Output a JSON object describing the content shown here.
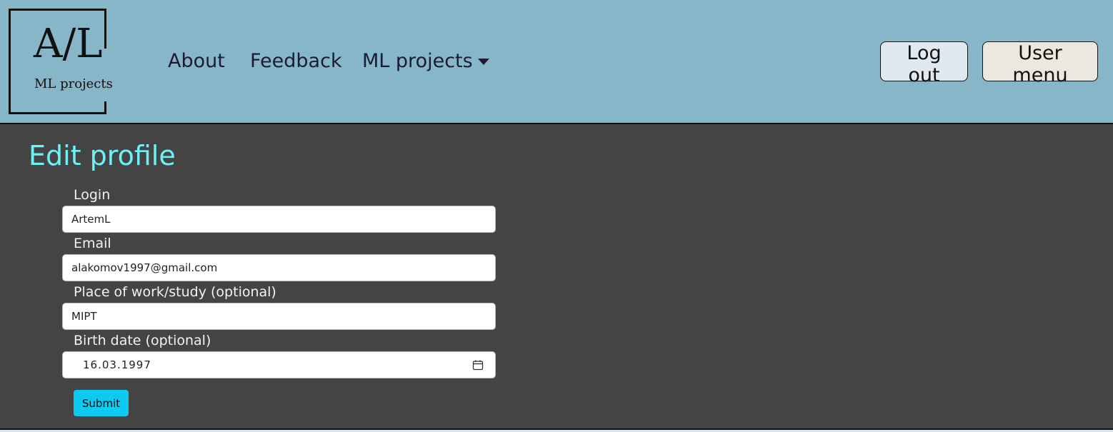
{
  "logo": {
    "big": "A/L",
    "small": "ML projects"
  },
  "nav": {
    "about": "About",
    "feedback": "Feedback",
    "ml_projects": "ML projects",
    "logout": "Log out",
    "user_menu": "User menu"
  },
  "page": {
    "title": "Edit profile"
  },
  "form": {
    "login_label": "Login",
    "login_value": "ArtemL",
    "email_label": "Email",
    "email_value": "alakomov1997@gmail.com",
    "work_label": "Place of work/study (optional)",
    "work_value": "MIPT",
    "birth_label": "Birth date (optional)",
    "birth_value": "16.03.1997",
    "submit_label": "Submit"
  },
  "colors": {
    "navbar": "#87b6c9",
    "background": "#444444",
    "title": "#6ff0f5",
    "submit": "#0dcaf0"
  },
  "icons": {
    "calendar": "calendar-icon",
    "dropdown": "chevron-down-icon"
  }
}
